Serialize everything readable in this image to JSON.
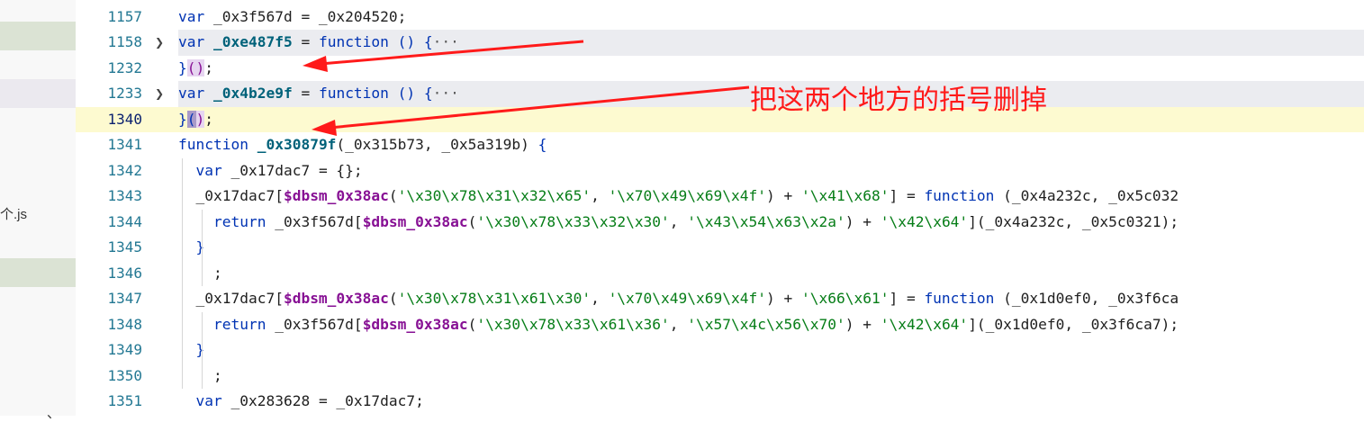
{
  "sidebar": {
    "file_fragment": "个.js",
    "bottom_fragment": "、"
  },
  "editor": {
    "lines": [
      {
        "num": "1157",
        "fold": false,
        "tokens": [
          [
            "kw",
            "var "
          ],
          [
            "id",
            "_0x3f567d = _0x204520;"
          ]
        ]
      },
      {
        "num": "1158",
        "fold": true,
        "tokens": [
          [
            "kw",
            "var "
          ],
          [
            "def",
            "_0xe487f5"
          ],
          [
            "id",
            " = "
          ],
          [
            "fn",
            "function "
          ],
          [
            "br1",
            "("
          ],
          [
            "br1",
            ")"
          ],
          [
            "id",
            " "
          ],
          [
            "br1",
            "{"
          ],
          [
            "ellip",
            "···"
          ]
        ]
      },
      {
        "num": "1232",
        "fold": false,
        "tokens": [
          [
            "br1",
            "}"
          ],
          [
            "br2",
            "()"
          ],
          [
            "id",
            ";"
          ]
        ]
      },
      {
        "num": "1233",
        "fold": true,
        "tokens": [
          [
            "kw",
            "var "
          ],
          [
            "def",
            "_0x4b2e9f"
          ],
          [
            "id",
            " = "
          ],
          [
            "fn",
            "function "
          ],
          [
            "br1",
            "("
          ],
          [
            "br1",
            ")"
          ],
          [
            "id",
            " "
          ],
          [
            "br1",
            "{"
          ],
          [
            "ellip",
            "···"
          ]
        ]
      },
      {
        "num": "1340",
        "fold": false,
        "current": true,
        "tokens": [
          [
            "br1",
            "}"
          ],
          [
            "sel",
            "("
          ],
          [
            "br2",
            ")"
          ],
          [
            "id",
            ";"
          ]
        ]
      },
      {
        "num": "1341",
        "fold": false,
        "tokens": [
          [
            "kw",
            "function "
          ],
          [
            "def",
            "_0x30879f"
          ],
          [
            "id",
            "(_0x315b73, _0x5a319b) "
          ],
          [
            "br1",
            "{"
          ]
        ]
      },
      {
        "num": "1342",
        "fold": false,
        "tokens": [
          [
            "id",
            "  "
          ],
          [
            "kw",
            "var "
          ],
          [
            "id",
            "_0x17dac7 = {};"
          ]
        ]
      },
      {
        "num": "1343",
        "fold": false,
        "tokens": [
          [
            "id",
            "  _0x17dac7["
          ],
          [
            "bold-id",
            "$dbsm_0x38ac"
          ],
          [
            "id",
            "("
          ],
          [
            "str",
            "'\\x30\\x78\\x31\\x32\\x65'"
          ],
          [
            "id",
            ", "
          ],
          [
            "str",
            "'\\x70\\x49\\x69\\x4f'"
          ],
          [
            "id",
            ") + "
          ],
          [
            "str",
            "'\\x41\\x68'"
          ],
          [
            "id",
            "] = "
          ],
          [
            "kw",
            "function "
          ],
          [
            "id",
            "(_0x4a232c, _0x5c032"
          ]
        ]
      },
      {
        "num": "1344",
        "fold": false,
        "tokens": [
          [
            "id",
            "    "
          ],
          [
            "kw",
            "return "
          ],
          [
            "id",
            "_0x3f567d["
          ],
          [
            "bold-id",
            "$dbsm_0x38ac"
          ],
          [
            "id",
            "("
          ],
          [
            "str",
            "'\\x30\\x78\\x33\\x32\\x30'"
          ],
          [
            "id",
            ", "
          ],
          [
            "str",
            "'\\x43\\x54\\x63\\x2a'"
          ],
          [
            "id",
            ") + "
          ],
          [
            "str",
            "'\\x42\\x64'"
          ],
          [
            "id",
            "](_0x4a232c, _0x5c0321);"
          ]
        ]
      },
      {
        "num": "1345",
        "fold": false,
        "tokens": [
          [
            "id",
            "  "
          ],
          [
            "br1",
            "}"
          ]
        ]
      },
      {
        "num": "1346",
        "fold": false,
        "tokens": [
          [
            "id",
            "    ;"
          ]
        ]
      },
      {
        "num": "1347",
        "fold": false,
        "tokens": [
          [
            "id",
            "  _0x17dac7["
          ],
          [
            "bold-id",
            "$dbsm_0x38ac"
          ],
          [
            "id",
            "("
          ],
          [
            "str",
            "'\\x30\\x78\\x31\\x61\\x30'"
          ],
          [
            "id",
            ", "
          ],
          [
            "str",
            "'\\x70\\x49\\x69\\x4f'"
          ],
          [
            "id",
            ") + "
          ],
          [
            "str",
            "'\\x66\\x61'"
          ],
          [
            "id",
            "] = "
          ],
          [
            "kw",
            "function "
          ],
          [
            "id",
            "(_0x1d0ef0, _0x3f6ca"
          ]
        ]
      },
      {
        "num": "1348",
        "fold": false,
        "tokens": [
          [
            "id",
            "    "
          ],
          [
            "kw",
            "return "
          ],
          [
            "id",
            "_0x3f567d["
          ],
          [
            "bold-id",
            "$dbsm_0x38ac"
          ],
          [
            "id",
            "("
          ],
          [
            "str",
            "'\\x30\\x78\\x33\\x61\\x36'"
          ],
          [
            "id",
            ", "
          ],
          [
            "str",
            "'\\x57\\x4c\\x56\\x70'"
          ],
          [
            "id",
            ") + "
          ],
          [
            "str",
            "'\\x42\\x64'"
          ],
          [
            "id",
            "](_0x1d0ef0, _0x3f6ca7);"
          ]
        ]
      },
      {
        "num": "1349",
        "fold": false,
        "tokens": [
          [
            "id",
            "  "
          ],
          [
            "br1",
            "}"
          ]
        ]
      },
      {
        "num": "1350",
        "fold": false,
        "tokens": [
          [
            "id",
            "    ;"
          ]
        ]
      },
      {
        "num": "1351",
        "fold": false,
        "tokens": [
          [
            "id",
            "  "
          ],
          [
            "kw",
            "var "
          ],
          [
            "id",
            "_0x283628 = _0x17dac7;"
          ]
        ]
      }
    ]
  },
  "annotation": {
    "text": "把这两个地方的括号删掉",
    "color": "#ff1a1a"
  },
  "colors": {
    "keyword": "#0033b3",
    "string": "#067d17",
    "line_number": "#237893",
    "current_line_bg": "#fdfad0",
    "folded_line_bg": "#ebecf0"
  }
}
